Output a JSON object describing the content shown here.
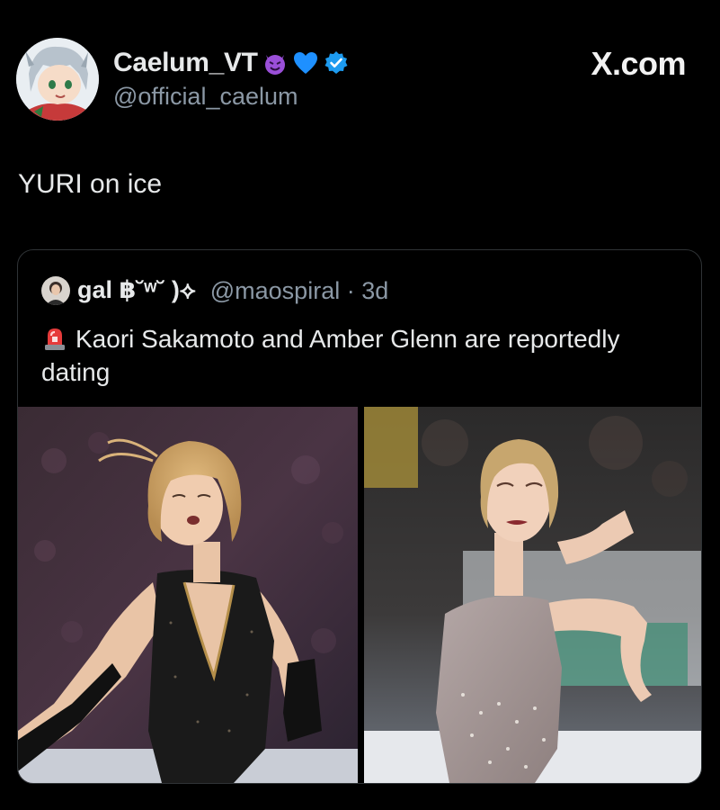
{
  "tweet": {
    "author": {
      "display_name": "Caelum_VT",
      "handle": "@official_caelum",
      "avatar_icon": "anime-avatar",
      "name_badges": [
        "purple-devil-emoji-icon",
        "blue-heart-emoji-icon",
        "verified-badge-icon"
      ]
    },
    "source_label": "X.com",
    "text": "YURI on ice"
  },
  "quoted_tweet": {
    "author": {
      "display_name": "gal ฿˘ʷ˘ )⟡",
      "handle_time": "@maospiral · 3d",
      "avatar_icon": "user-avatar"
    },
    "siren_icon": "police-siren-emoji-icon",
    "text": "Kaori Sakamoto and Amber Glenn are reportedly dating",
    "media": [
      {
        "name": "skater-photo-left",
        "description_icon": "figure-skater-black-dress-photo"
      },
      {
        "name": "skater-photo-right",
        "description_icon": "figure-skater-grey-dress-photo"
      }
    ]
  },
  "colors": {
    "background": "#000000",
    "primary_text": "#e7e9ea",
    "secondary_text": "#8b98a5",
    "border": "#2f3336",
    "verified_blue": "#1d9bf0"
  }
}
